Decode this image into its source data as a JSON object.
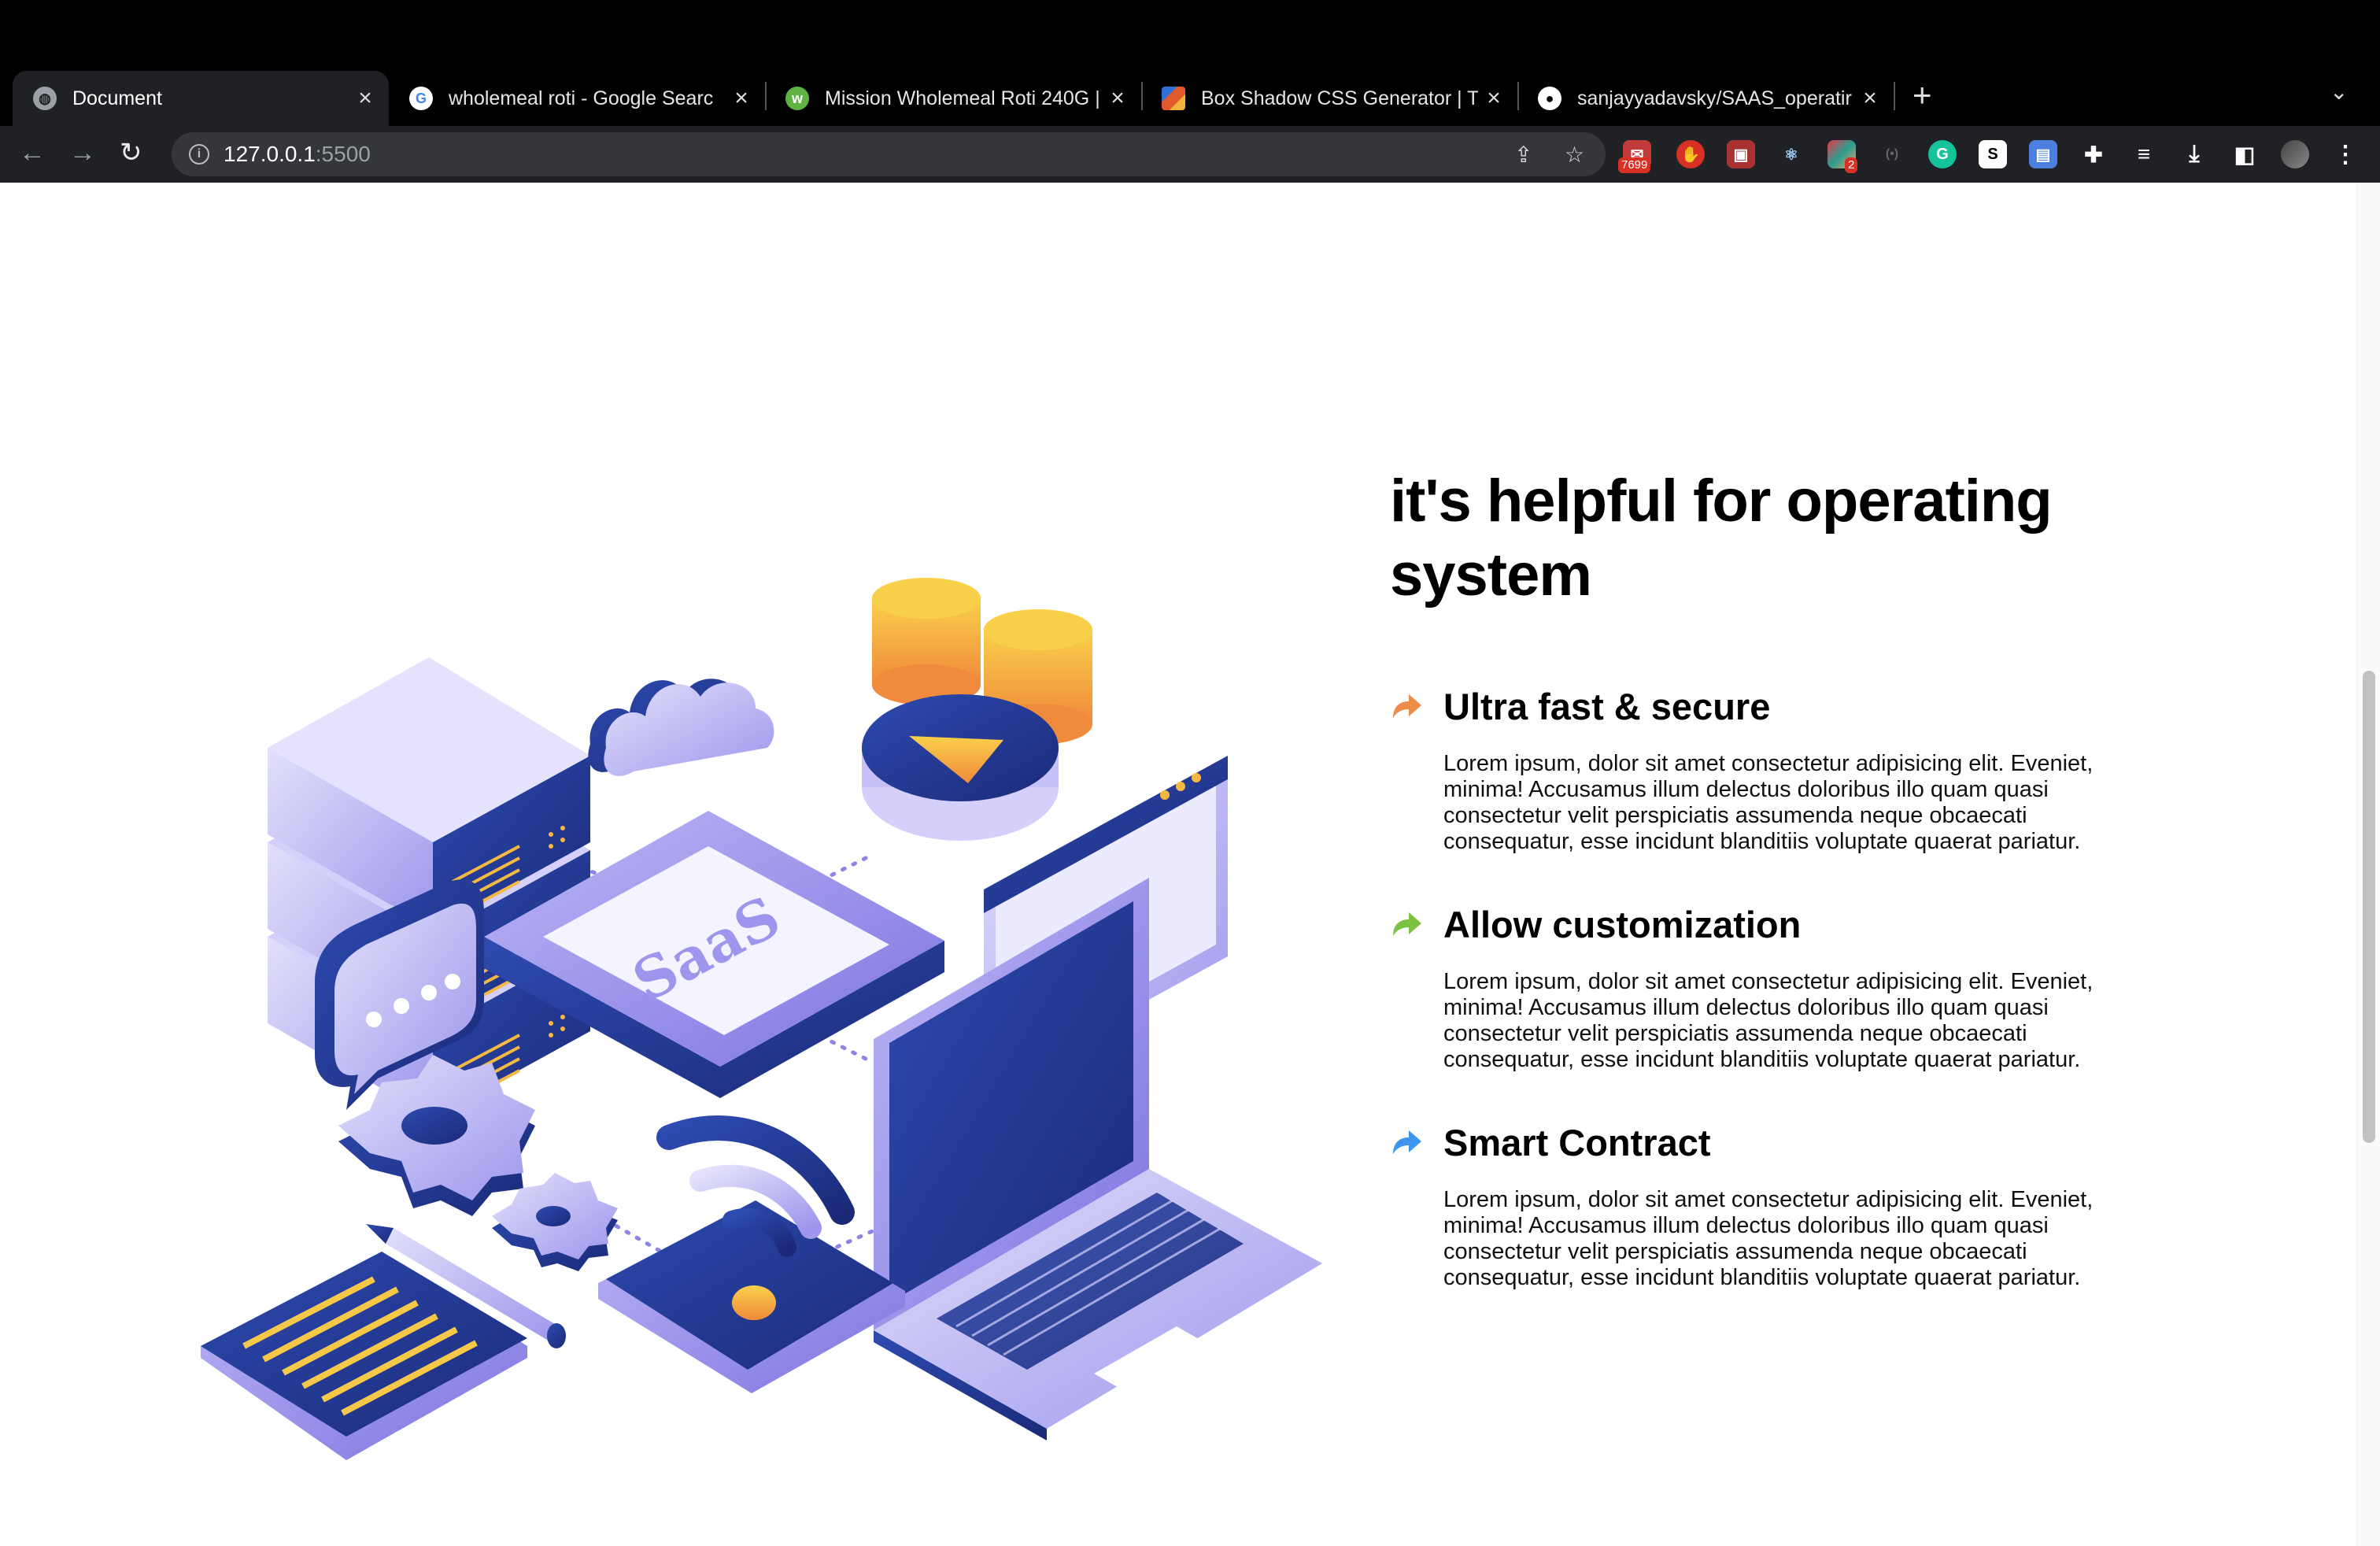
{
  "browser": {
    "tabs": [
      {
        "title": "Document",
        "icon": "globe-icon",
        "active": true
      },
      {
        "title": "wholemeal roti - Google Searc",
        "icon": "google-icon"
      },
      {
        "title": "Mission Wholemeal Roti 240G |",
        "icon": "woolworths-icon"
      },
      {
        "title": "Box Shadow CSS Generator | T",
        "icon": "cssmatic-icon"
      },
      {
        "title": "sanjayyadavsky/SAAS_operatir",
        "icon": "github-icon"
      }
    ],
    "url_host": "127.0.0.1",
    "url_port": ":5500",
    "extensions": [
      {
        "name": "mail-icon",
        "badge": "7699"
      },
      {
        "name": "adblock-icon"
      },
      {
        "name": "image-icon"
      },
      {
        "name": "react-icon"
      },
      {
        "name": "colorzilla-icon",
        "badge": "2"
      },
      {
        "name": "broadcast-icon"
      },
      {
        "name": "grammarly-icon"
      },
      {
        "name": "s-icon"
      },
      {
        "name": "clipboard-icon"
      },
      {
        "name": "puzzle-icon"
      },
      {
        "name": "reading-list-icon"
      },
      {
        "name": "download-icon"
      },
      {
        "name": "sidepanel-icon"
      },
      {
        "name": "profile-avatar"
      },
      {
        "name": "menu-icon"
      }
    ]
  },
  "main": {
    "heading": "it's helpful for operating system",
    "illustration_label": "SaaS",
    "features": [
      {
        "title": "Ultra fast & secure",
        "arrow_color": "#ee8a4a",
        "body": "Lorem ipsum, dolor sit amet consectetur adipisicing elit. Eveniet, minima! Accusamus illum delectus doloribus illo quam quasi consectetur velit perspiciatis assumenda neque obcaecati consequatur, esse incidunt blanditiis voluptate quaerat pariatur."
      },
      {
        "title": "Allow customization",
        "arrow_color": "#7cc242",
        "body": "Lorem ipsum, dolor sit amet consectetur adipisicing elit. Eveniet, minima! Accusamus illum delectus doloribus illo quam quasi consectetur velit perspiciatis assumenda neque obcaecati consequatur, esse incidunt blanditiis voluptate quaerat pariatur."
      },
      {
        "title": "Smart Contract",
        "arrow_color": "#3d95ee",
        "body": "Lorem ipsum, dolor sit amet consectetur adipisicing elit. Eveniet, minima! Accusamus illum delectus doloribus illo quam quasi consectetur velit perspiciatis assumenda neque obcaecati consequatur, esse incidunt blanditiis voluptate quaerat pariatur."
      }
    ]
  }
}
